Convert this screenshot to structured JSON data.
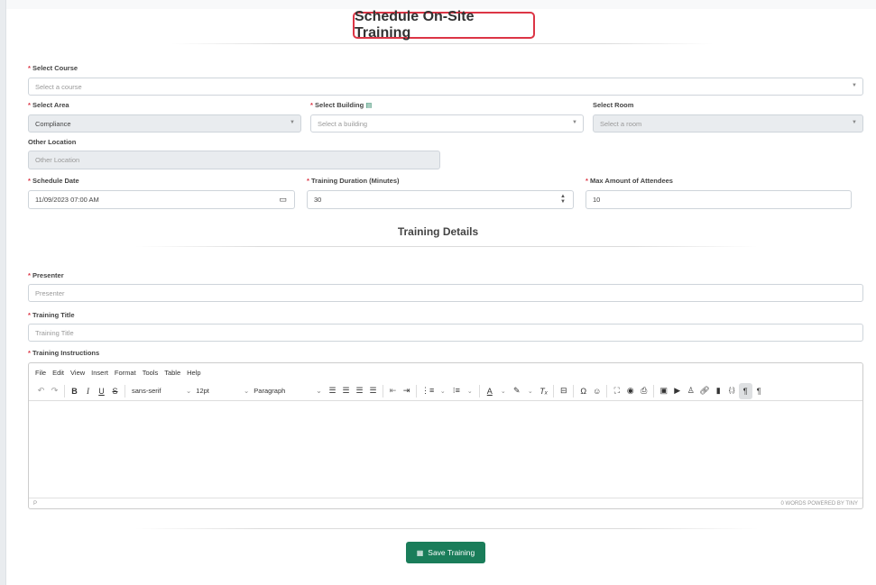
{
  "page": {
    "title": "Schedule On-Site Training"
  },
  "form": {
    "course": {
      "label": "Select Course",
      "placeholder": "Select a course"
    },
    "area": {
      "label": "Select Area",
      "value": "Compliance"
    },
    "building": {
      "label": "Select Building",
      "placeholder": "Select a building"
    },
    "room": {
      "label": "Select Room",
      "placeholder": "Select a room"
    },
    "other_location": {
      "label": "Other Location",
      "placeholder": "Other Location"
    },
    "schedule_date": {
      "label": "Schedule Date",
      "value": "11/09/2023 07:00 AM"
    },
    "duration": {
      "label": "Training Duration (Minutes)",
      "value": "30"
    },
    "max_attendees": {
      "label": "Max Amount of Attendees",
      "value": "10"
    },
    "required_mark": "*"
  },
  "details": {
    "heading": "Training Details",
    "presenter": {
      "label": "Presenter",
      "placeholder": "Presenter"
    },
    "training_title": {
      "label": "Training Title",
      "placeholder": "Training Title"
    },
    "instructions": {
      "label": "Training Instructions"
    }
  },
  "editor": {
    "menu": [
      "File",
      "Edit",
      "View",
      "Insert",
      "Format",
      "Tools",
      "Table",
      "Help"
    ],
    "font_family": "sans-serif",
    "font_size": "12pt",
    "block_format": "Paragraph",
    "path": "P",
    "status_right": "0 WORDS  POWERED BY TINY"
  },
  "actions": {
    "save_label": "Save Training"
  },
  "colors": {
    "accent": "#1a7d5a",
    "highlight": "#dc3545"
  }
}
